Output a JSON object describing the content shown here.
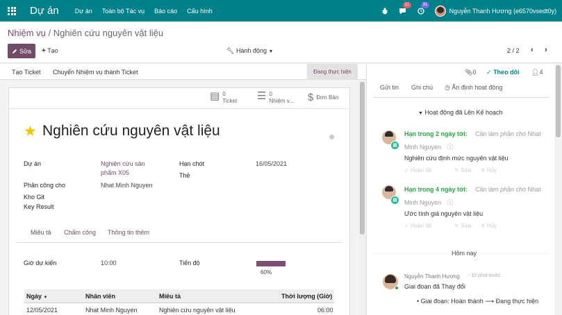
{
  "navbar": {
    "brand": "Dự án",
    "menu": [
      "Dự án",
      "Toàn bộ Tác vụ",
      "Báo cáo",
      "Cấu hình"
    ],
    "messages_count": "11",
    "activities_count": "31",
    "user": "Nguyễn Thanh Hương (e6570vsedt0y)"
  },
  "control": {
    "breadcrumb_parent": "Nhiệm vụ",
    "breadcrumb_sep": "/",
    "breadcrumb_current": "Nghiên cứu nguyên vật liệu",
    "edit_label": "Sửa",
    "create_label": "Tạo",
    "action_label": "Hành động",
    "pager": "2 / 2"
  },
  "statusbar": {
    "create_ticket": "Tạo Ticket",
    "convert_ticket": "Chuyển Nhiệm vụ thành Ticket",
    "stage": "Đang thực hiện"
  },
  "smart_buttons": [
    {
      "value": "0",
      "label": "Ticket"
    },
    {
      "value": "0",
      "label": "Nhiệm v..."
    },
    {
      "value": "",
      "label": "Đơn Bán"
    }
  ],
  "form": {
    "title": "Nghiên cứu nguyên vật liệu",
    "project_label": "Dự án",
    "project_line1": "Nghiên cứu sản",
    "project_line2": "phẩm X05",
    "assigned_label": "Phân công cho",
    "assigned_value": "Nhat Minh Nguyen",
    "git_label": "Kho Git",
    "kr_label": "Key Result",
    "deadline_label": "Hạn chót",
    "deadline_value": "16/05/2021",
    "tags_label": "Thẻ",
    "tabs": [
      "Miêu tả",
      "Chấm công",
      "Thông tin thêm"
    ],
    "planned_label": "Giờ dự kiến",
    "planned_value": "10:00",
    "progress_label": "Tiến độ",
    "progress_value": "60%",
    "progress_fraction": 0.6,
    "table_headers": [
      "Ngày",
      "Nhân viên",
      "Miêu tả",
      "Thời lượng (Giờ)"
    ],
    "table_rows": [
      [
        "12/05/2021",
        "Nhat Minh Nguyen",
        "Nghiên cứu nguyên vật liệu",
        "06:00"
      ]
    ]
  },
  "chatter": {
    "attachments": "0",
    "follow": "Theo dõi",
    "followers": "4",
    "send_message": "Gửi tin",
    "log_note": "Ghi chú",
    "schedule": "Ấn định hoạt động",
    "planned_header": "Hoạt động đã Lên Kế hoạch",
    "activities": [
      {
        "due": "Hạn trong 2 ngày tới:",
        "meta_prefix": "Cần làm",
        "meta_for": "phần cho",
        "meta_user_a": "Nhat",
        "meta_user_b": "Minh Nguyen",
        "summary": "Nghiên cứu định mức nguyên vật liệu",
        "done": "Hoàn tất",
        "edit": "Sửa",
        "cancel": "Hủy"
      },
      {
        "due": "Hạn trong 4 ngày tới:",
        "meta_prefix": "Cần làm",
        "meta_for": "phần cho",
        "meta_user_a": "Nhat",
        "meta_user_b": "Minh Nguyen",
        "summary": "Ước tính giá nguyên vật liệu",
        "done": "Hoàn tất",
        "edit": "Sửa",
        "cancel": "Hủy"
      }
    ],
    "today": "Hôm nay",
    "message": {
      "author": "Nguyễn Thanh Hương",
      "time": "- 10 phút trước",
      "body": "Giai đoạn đã Thay đổi",
      "tracking": "Giai đoạn: Hoàn thành ⟶ Đang thực hiện"
    }
  },
  "colors": {
    "navbar": "#00818a",
    "primary": "#714b67",
    "due_soon": "#28a745",
    "star": "#f3c200"
  }
}
